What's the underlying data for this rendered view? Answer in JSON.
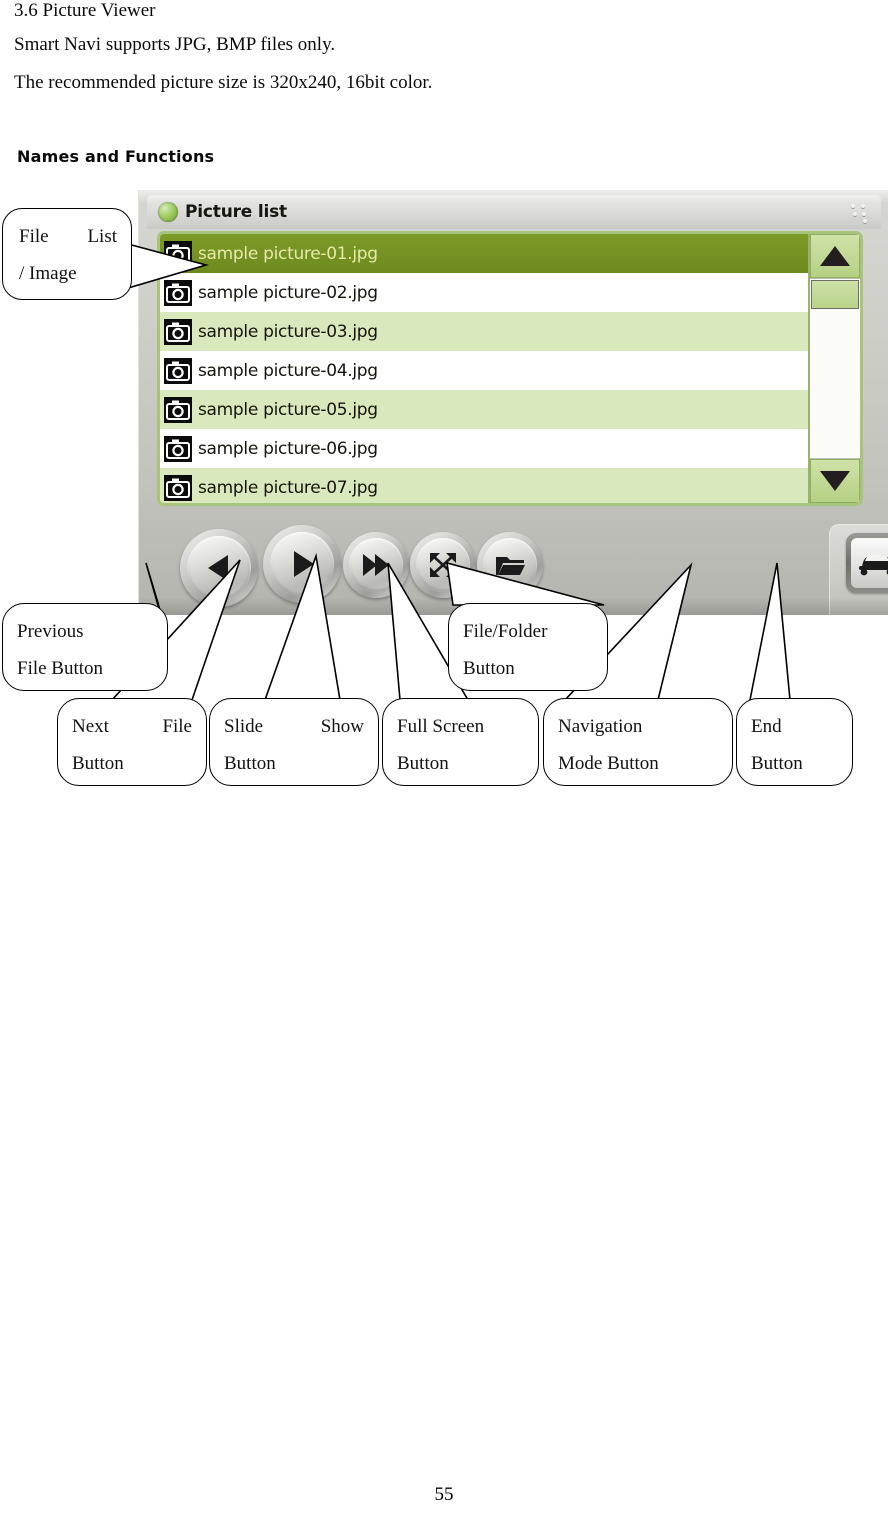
{
  "document": {
    "heading": "3.6 Picture Viewer",
    "line1": "Smart Navi supports JPG, BMP files only.",
    "line2": "The recommended picture size is 320x240, 16bit color.",
    "section_heading": "Names and Functions",
    "page_number": "55"
  },
  "device": {
    "titlebar": {
      "title": "Picture list",
      "led_color": "#9fce63",
      "grip_icon": "dots-grip-icon"
    },
    "file_list": {
      "selected_index": 0,
      "selected_bg": "#6d8a1f",
      "selected_text_color": "#e8e8a8",
      "alt_row_bg": "#d9e8bd",
      "row_bg": "#ffffff",
      "border_color": "#a7c47b",
      "items": [
        {
          "name": "sample picture-01.jpg",
          "icon": "camera-icon"
        },
        {
          "name": "sample picture-02.jpg",
          "icon": "camera-icon"
        },
        {
          "name": "sample picture-03.jpg",
          "icon": "camera-icon"
        },
        {
          "name": "sample picture-04.jpg",
          "icon": "camera-icon"
        },
        {
          "name": "sample picture-05.jpg",
          "icon": "camera-icon"
        },
        {
          "name": "sample picture-06.jpg",
          "icon": "camera-icon"
        },
        {
          "name": "sample picture-07.jpg",
          "icon": "camera-icon"
        }
      ]
    },
    "scrollbar": {
      "up_icon": "triangle-up-icon",
      "down_icon": "triangle-down-icon",
      "thumb_position_percent": 2
    },
    "buttons": [
      {
        "id": "previous",
        "icon": "triangle-left-icon"
      },
      {
        "id": "slideshow",
        "icon": "triangle-right-play-icon"
      },
      {
        "id": "next",
        "icon": "double-triangle-right-icon"
      },
      {
        "id": "fullscreen",
        "icon": "expand-arrows-icon"
      },
      {
        "id": "filefolder",
        "icon": "folder-icon"
      },
      {
        "id": "navigation",
        "icon": "car-icon"
      },
      {
        "id": "end",
        "icon": "arrow-exit-icon"
      }
    ]
  },
  "callouts": {
    "file_list": {
      "line1": "File",
      "line1b": "List",
      "line2": "/ Image"
    },
    "previous": {
      "line1": "Previous",
      "line2": "File Button"
    },
    "next": {
      "line1": "Next",
      "line1b": "File",
      "line2": "Button"
    },
    "slideshow": {
      "line1": "Slide",
      "line1b": "Show",
      "line2": "Button"
    },
    "fullscreen": {
      "line1": "Full Screen",
      "line2": "Button"
    },
    "filefolder": {
      "line1": "File/Folder",
      "line2": "Button"
    },
    "navigation": {
      "line1": "Navigation",
      "line2": "Mode Button"
    },
    "end": {
      "line1": "End",
      "line2": "Button"
    }
  }
}
